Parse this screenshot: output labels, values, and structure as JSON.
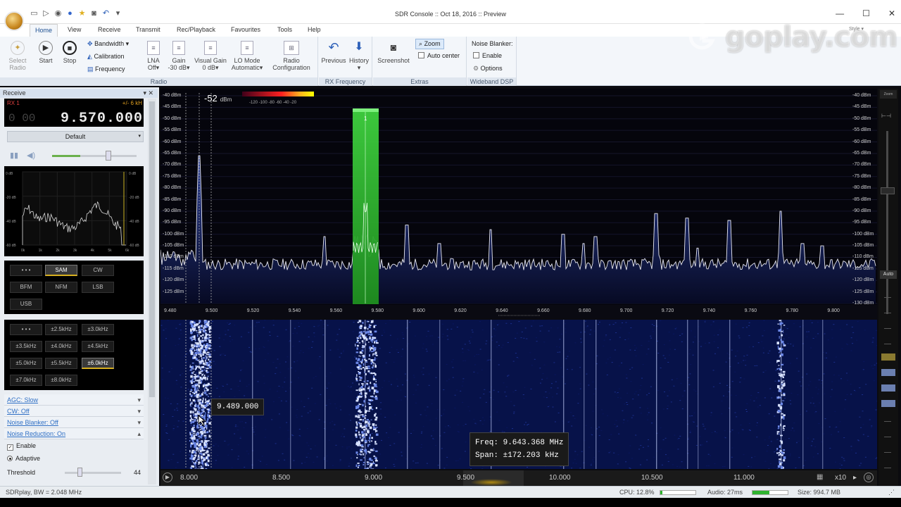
{
  "window": {
    "title": "SDR Console :: Oct 18, 2016 :: Preview",
    "minimize": "—",
    "maximize": "☐",
    "close": "✕"
  },
  "ribbon_tabs": [
    "Home",
    "View",
    "Receive",
    "Transmit",
    "Rec/Playback",
    "Favourites",
    "Tools",
    "Help"
  ],
  "ribbon": {
    "radio": {
      "label": "Radio",
      "select_radio": "Select\nRadio",
      "start": "Start",
      "stop": "Stop",
      "bandwidth": "Bandwidth",
      "calibration": "Calibration",
      "frequency": "Frequency",
      "lna": "LNA",
      "lna_val": "Off",
      "gain": "Gain",
      "gain_val": "-30 dB",
      "visual_gain": "Visual Gain",
      "visual_gain_val": "0 dB",
      "lo_mode": "LO Mode",
      "lo_mode_val": "Automatic",
      "radio_config": "Radio\nConfiguration"
    },
    "rx_frequency": {
      "label": "RX Frequency",
      "previous": "Previous",
      "history": "History"
    },
    "extras": {
      "label": "Extras",
      "screenshot": "Screenshot",
      "zoom": "Zoom",
      "auto_center": "Auto center"
    },
    "wideband_dsp": {
      "label": "Wideband DSP",
      "noise_blanker": "Noise Blanker:",
      "enable": "Enable",
      "options": "Options"
    }
  },
  "watermark": "goplay.com",
  "style_label": "Style",
  "receive_panel": {
    "title": "Receive",
    "rx_label": "RX 1",
    "bw_label": "+/- 6 kH",
    "frequency": "9.570.000",
    "ghost_digits": "0 00",
    "preset": "Default",
    "modes": [
      "• • •",
      "SAM",
      "CW",
      "BFM",
      "NFM",
      "LSB",
      "USB"
    ],
    "selected_mode": "SAM",
    "bandwidths": [
      "• • •",
      "±2.5kHz",
      "±3.0kHz",
      "±3.5kHz",
      "±4.0kHz",
      "±4.5kHz",
      "±5.0kHz",
      "±5.5kHz",
      "±6.0kHz",
      "±7.0kHz",
      "±8.0kHz"
    ],
    "selected_bandwidth": "±6.0kHz",
    "mini_spectrum": {
      "y_left": [
        "0 dB",
        "-20 dB",
        "-40 dB",
        "-60 dB"
      ],
      "y_right": [
        "0 dB",
        "-20 dB",
        "-40 dB",
        "-60 dB"
      ],
      "x": [
        "0k",
        "1k",
        "2k",
        "3k",
        "4k",
        "5k",
        "6k"
      ]
    },
    "agc": "AGC: Slow",
    "cw": "CW: Off",
    "noise_blanker": "Noise Blanker: Off",
    "noise_reduction": "Noise Reduction: On",
    "enable": "Enable",
    "adaptive": "Adaptive",
    "threshold_label": "Threshold",
    "threshold_value": "44"
  },
  "spectrum": {
    "level_readout": "-52",
    "level_unit": "dBm",
    "colorbar_ticks": "-120  -100   -80   -60   -40   -20",
    "db_labels": [
      "-40 dBm",
      "-45 dBm",
      "-50 dBm",
      "-55 dBm",
      "-60 dBm",
      "-65 dBm",
      "-70 dBm",
      "-75 dBm",
      "-80 dBm",
      "-85 dBm",
      "-90 dBm",
      "-95 dBm",
      "-100 dBm",
      "-105 dBm",
      "-110 dBm",
      "-115 dBm",
      "-120 dBm",
      "-125 dBm",
      "-130 dBm"
    ],
    "freq_labels": [
      "9.480",
      "9.500",
      "9.520",
      "9.540",
      "9.560",
      "9.580",
      "9.600",
      "9.620",
      "9.640",
      "9.660",
      "9.680",
      "9.700",
      "9.720",
      "9.740",
      "9.760",
      "9.780",
      "9.800"
    ],
    "channel_marker": "1",
    "zoom_label": "Zoom",
    "auto_label": "Auto"
  },
  "waterfall": {
    "cursor_freq": "9.489.000",
    "readout_freq": "Freq: 9.643.368 MHz",
    "readout_span": "Span:  ±172.203 kHz"
  },
  "overview_bar": {
    "labels": [
      "8.000",
      "8.500",
      "9.000",
      "9.500",
      "10.000",
      "10.500",
      "11.000"
    ],
    "zoom_factor": "x10"
  },
  "statusbar": {
    "left": "SDRplay, BW = 2.048 MHz",
    "cpu": "CPU: 12.8%",
    "cpu_level": 0.06,
    "audio": "Audio: 27ms",
    "audio_level": 0.48,
    "size": "Size: 994.7 MB"
  }
}
